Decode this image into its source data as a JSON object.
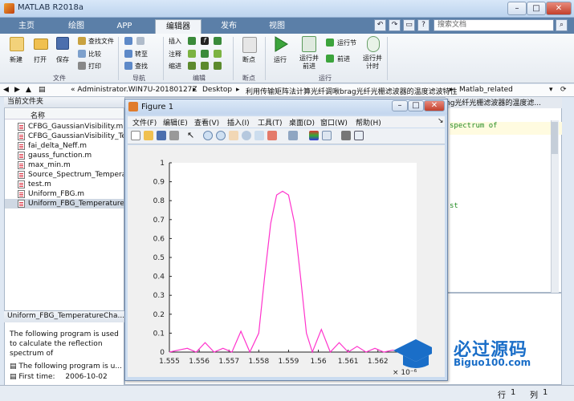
{
  "window": {
    "title": "MATLAB R2018a",
    "controls": [
      "–",
      "□",
      "✕"
    ]
  },
  "tabs": [
    {
      "label": "主页"
    },
    {
      "label": "绘图"
    },
    {
      "label": "APP"
    },
    {
      "label": "编辑器",
      "active": true
    },
    {
      "label": "发布"
    },
    {
      "label": "视图"
    }
  ],
  "search": {
    "placeholder": "搜索文档"
  },
  "ribbon": {
    "file": {
      "new": "新建",
      "open": "打开",
      "save": "保存",
      "find_files": "查找文件",
      "compare": "比较",
      "print": "打印",
      "group": "文件"
    },
    "nav": {
      "goto": "转至",
      "find": "查找",
      "group": "导航"
    },
    "edit": {
      "insert": "插入",
      "comment": "注释",
      "indent": "缩进",
      "group": "编辑"
    },
    "breakpoints": {
      "label": "断点",
      "group": "断点"
    },
    "run": {
      "run": "运行",
      "run_advance": "运行并\n前进",
      "run_section": "运行节",
      "advance": "前进",
      "run_time": "运行并\n计时",
      "group": "运行"
    }
  },
  "path": {
    "segments": [
      "« Administrator.WIN7U-20180127Z",
      "Desktop",
      "利用传输矩阵法计算光纤调啾brag光纤光栅滤波器的温度滤波特性",
      "Matlab_related"
    ]
  },
  "current_folder": {
    "title": "当前文件夹",
    "column": "名称",
    "files": [
      "CFBG_GaussianVisibility.m",
      "CFBG_GaussianVisibility_Tem",
      "fai_delta_Neff.m",
      "gauss_function.m",
      "max_min.m",
      "Source_Spectrum_Temperatur",
      "test.m",
      "Uniform_FBG.m",
      "Uniform_FBG_TemperatureCh"
    ],
    "selected_index": 8
  },
  "details": {
    "title": "Uniform_FBG_TemperatureCha...",
    "desc": [
      "The following program is used",
      "to calculate the reflection",
      "spectrum of"
    ],
    "item1": "The following program is u...",
    "item2_label": "First time:",
    "item2_value": "2006-10-02"
  },
  "editor": {
    "tab_text": "ng光纤光栅滤波器的温度滤...",
    "code_snippet": "spectrum of",
    "side_snippet": "st"
  },
  "status": {
    "line_label": "行",
    "line_value": "1",
    "col_label": "列",
    "col_value": "1"
  },
  "figure": {
    "title": "Figure 1",
    "menu": [
      "文件(F)",
      "编辑(E)",
      "查看(V)",
      "插入(I)",
      "工具(T)",
      "桌面(D)",
      "窗口(W)",
      "帮助(H)"
    ],
    "toolbar_icons": [
      "new-icon",
      "open-icon",
      "save-icon",
      "print-icon",
      "pointer-icon",
      "zoom-in-icon",
      "zoom-out-icon",
      "pan-icon",
      "rotate-icon",
      "datacursor-icon",
      "brush-icon",
      "link-icon",
      "colorbar-icon",
      "legend-icon",
      "hide-icon",
      "show-icon"
    ]
  },
  "chart_data": {
    "type": "line",
    "title": "",
    "xlabel": "",
    "ylabel": "",
    "x_exponent": "× 10⁻⁶",
    "xlim": [
      1.555,
      1.5633
    ],
    "ylim": [
      0,
      1
    ],
    "xticks": [
      "1.555",
      "1.556",
      "1.557",
      "1.558",
      "1.559",
      "1.56",
      "1.561",
      "1.562"
    ],
    "yticks": [
      "0",
      "0.1",
      "0.2",
      "0.3",
      "0.4",
      "0.5",
      "0.6",
      "0.7",
      "0.8",
      "0.9",
      "1"
    ],
    "grid": false,
    "color": "#ff33cc",
    "series": [
      {
        "x": [
          1.555,
          1.5553,
          1.5556,
          1.5559,
          1.5562,
          1.5565,
          1.5568,
          1.5571,
          1.5574,
          1.5577,
          1.558,
          1.5582,
          1.5584,
          1.5586,
          1.5588,
          1.559,
          1.5592,
          1.5594,
          1.5596,
          1.5598,
          1.5601,
          1.5604,
          1.5607,
          1.561,
          1.5613,
          1.5616,
          1.5619,
          1.5622,
          1.5625,
          1.5628,
          1.5631
        ],
        "y": [
          0.0,
          0.01,
          0.02,
          0.0,
          0.05,
          0.0,
          0.02,
          0.0,
          0.11,
          0.0,
          0.1,
          0.4,
          0.68,
          0.83,
          0.85,
          0.83,
          0.68,
          0.4,
          0.1,
          0.0,
          0.12,
          0.0,
          0.05,
          0.0,
          0.03,
          0.0,
          0.02,
          0.0,
          0.01,
          0.0,
          0.01
        ]
      }
    ]
  },
  "watermark": {
    "brand": "必过源码",
    "url": "Biguo100.com"
  }
}
